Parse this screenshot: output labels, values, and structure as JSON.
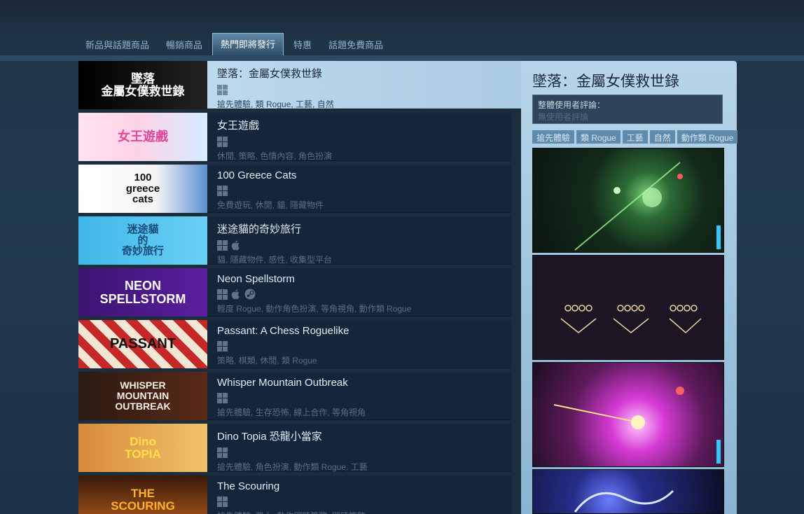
{
  "tabs": [
    {
      "label": "新品與話題商品"
    },
    {
      "label": "暢銷商品"
    },
    {
      "label": "熱門即將發行"
    },
    {
      "label": "特惠"
    },
    {
      "label": "話題免費商品"
    }
  ],
  "games": [
    {
      "title": "墜落：金屬女僕救世錄",
      "tags": "搶先體驗, 類 Rogue, 工藝, 自然",
      "platforms": [
        "win"
      ],
      "thumb_text": "墜落\n金屬女僕救世錄"
    },
    {
      "title": "女王遊戲",
      "tags": "休閒, 策略, 色情內容, 角色扮演",
      "platforms": [
        "win"
      ],
      "thumb_text": "女王遊戲"
    },
    {
      "title": "100 Greece Cats",
      "tags": "免費遊玩, 休閒, 貓, 隱藏物件",
      "platforms": [
        "win"
      ],
      "thumb_text": "100\ngreece\ncats"
    },
    {
      "title": "迷途貓的奇妙旅行",
      "tags": "貓, 隱藏物件, 感性, 收集型平台",
      "platforms": [
        "win",
        "mac"
      ],
      "thumb_text": "迷途貓\n的\n奇妙旅行"
    },
    {
      "title": "Neon Spellstorm",
      "tags": "輕度 Rogue, 動作角色扮演, 等角視角, 動作類 Rogue",
      "platforms": [
        "win",
        "mac",
        "steam"
      ],
      "thumb_text": "NEON\nSPELLSTORM"
    },
    {
      "title": "Passant: A Chess Roguelike",
      "tags": "策略, 棋類, 休閒, 類 Rogue",
      "platforms": [
        "win"
      ],
      "thumb_text": "PASSANT"
    },
    {
      "title": "Whisper Mountain Outbreak",
      "tags": "搶先體驗, 生存恐怖, 線上合作, 等角視角",
      "platforms": [
        "win"
      ],
      "thumb_text": "WHISPER\nMOUNTAIN\nOUTBREAK"
    },
    {
      "title": "Dino Topia 恐龍小當家",
      "tags": "搶先體驗, 角色扮演, 動作類 Rogue, 工藝",
      "platforms": [
        "win"
      ],
      "thumb_text": "Dino\nTOPIA"
    },
    {
      "title": "The Scouring",
      "tags": "搶先體驗, 單人, 動作即時策略, 即時策略",
      "platforms": [
        "win"
      ],
      "thumb_text": "THE\nSCOURING"
    }
  ],
  "side": {
    "title": "墜落：金屬女僕救世錄",
    "review_label": "整體使用者評論：",
    "review_value": "無使用者評論",
    "tags": [
      "搶先體驗",
      "類 Rogue",
      "工藝",
      "自然",
      "動作類 Rogue"
    ]
  },
  "colors": {
    "highlight": "#c5dff1",
    "row_bg": "#16263a",
    "tag_bg": "#5d8aad"
  }
}
